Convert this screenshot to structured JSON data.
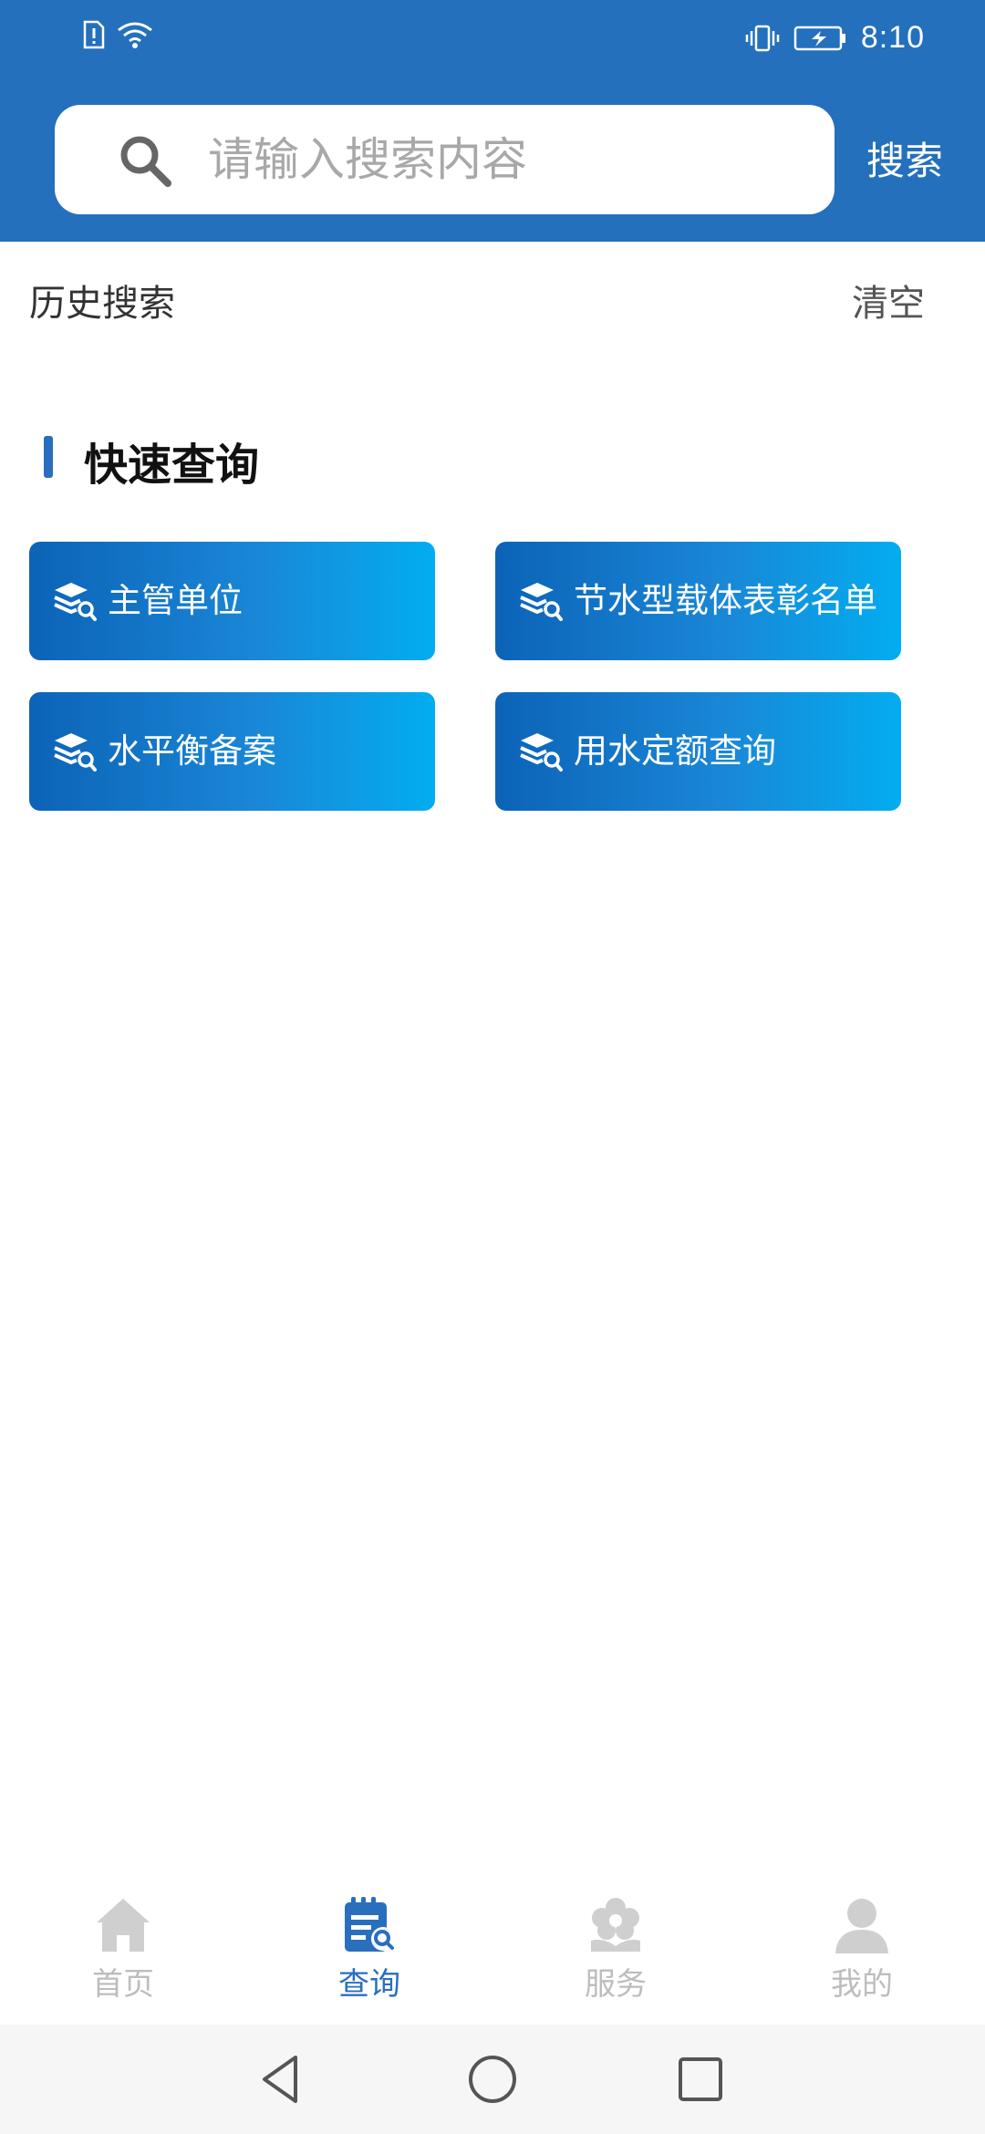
{
  "status_bar": {
    "time": "8:10",
    "icons": [
      "alert-sim-icon",
      "wifi-icon",
      "vibrate-icon",
      "battery-charging-icon"
    ]
  },
  "search": {
    "placeholder": "请输入搜索内容",
    "value": "",
    "button_label": "搜索"
  },
  "history": {
    "title": "历史搜索",
    "clear_label": "清空",
    "items": []
  },
  "quick_query": {
    "title": "快速查询",
    "accent_color": "#2a6fbe",
    "items": [
      {
        "label": "主管单位",
        "icon": "layers-search-icon"
      },
      {
        "label": "节水型载体表彰名单",
        "icon": "layers-search-icon"
      },
      {
        "label": "水平衡备案",
        "icon": "layers-search-icon"
      },
      {
        "label": "用水定额查询",
        "icon": "layers-search-icon"
      }
    ]
  },
  "bottom_nav": {
    "active_index": 1,
    "items": [
      {
        "label": "首页",
        "icon": "home-icon"
      },
      {
        "label": "查询",
        "icon": "query-document-icon"
      },
      {
        "label": "服务",
        "icon": "flower-service-icon"
      },
      {
        "label": "我的",
        "icon": "user-icon"
      }
    ]
  },
  "colors": {
    "header": "#2470bc",
    "button_gradient_start": "#0c63b7",
    "button_gradient_end": "#03adf0",
    "nav_active": "#2a6fbe",
    "nav_inactive": "#bdbdbd"
  }
}
